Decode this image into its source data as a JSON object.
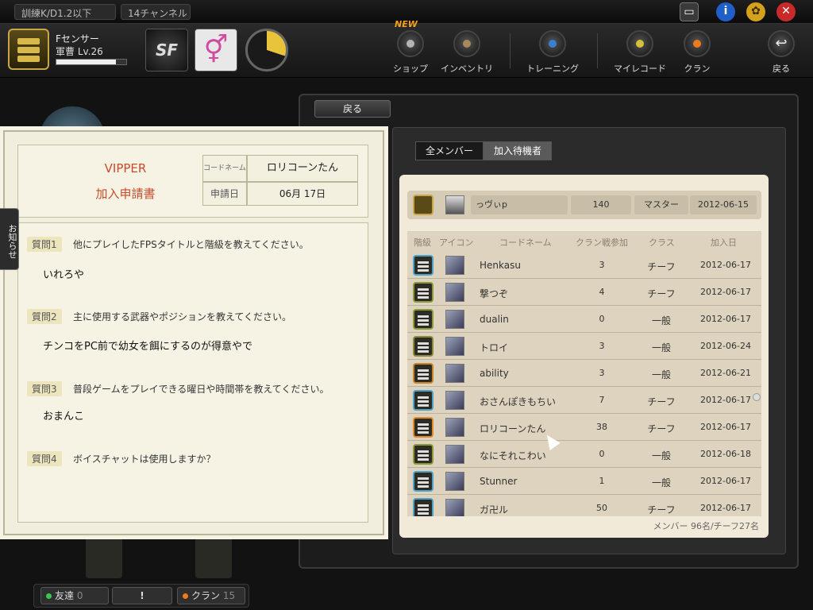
{
  "topbar": {
    "filter_label": "訓練K/D1.2以下",
    "channel_label": "14チャンネル"
  },
  "player": {
    "name": "Fセンサー",
    "rank": "軍曹 Lv.26",
    "xp_fraction": 0.85
  },
  "nav": {
    "new_badge": "NEW",
    "items": [
      {
        "label": "ショップ",
        "color": "#b5b5b5"
      },
      {
        "label": "インベントリ",
        "color": "#a88a5a"
      },
      {
        "label": "トレーニング",
        "color": "#3a7fd0"
      },
      {
        "label": "マイレコード",
        "color": "#d6c23a"
      },
      {
        "label": "クラン",
        "color": "#f07a1a"
      }
    ],
    "back_label": "戻る"
  },
  "panel": {
    "back_tab": "戻る",
    "tabs": [
      "全メンバー",
      "加入待機者"
    ]
  },
  "master": {
    "name": "っヴぃp",
    "count": "140",
    "class": "マスター",
    "date": "2012-06-15"
  },
  "columns": [
    "階級",
    "アイコン",
    "コードネーム",
    "クラン戦参加",
    "クラス",
    "加入日"
  ],
  "members": [
    {
      "name": "Henkasu",
      "count": "3",
      "class": "チーフ",
      "date": "2012-06-17",
      "rank_color": "#4ea2c8"
    },
    {
      "name": "撃つぞ",
      "count": "4",
      "class": "チーフ",
      "date": "2012-06-17",
      "rank_color": "#8a9a38"
    },
    {
      "name": "dualin",
      "count": "0",
      "class": "一般",
      "date": "2012-06-17",
      "rank_color": "#8a9a38"
    },
    {
      "name": "トロイ",
      "count": "3",
      "class": "一般",
      "date": "2012-06-24",
      "rank_color": "#8a8a38"
    },
    {
      "name": "ability",
      "count": "3",
      "class": "一般",
      "date": "2012-06-21",
      "rank_color": "#c8842a"
    },
    {
      "name": "おさんぽきもちい",
      "count": "7",
      "class": "チーフ",
      "date": "2012-06-17",
      "rank_color": "#4ea2c8"
    },
    {
      "name": "ロリコーンたん",
      "count": "38",
      "class": "チーフ",
      "date": "2012-06-17",
      "rank_color": "#e08a2a"
    },
    {
      "name": "なにそれこわい",
      "count": "0",
      "class": "一般",
      "date": "2012-06-18",
      "rank_color": "#8a9a38"
    },
    {
      "name": "Stunner",
      "count": "1",
      "class": "一般",
      "date": "2012-06-17",
      "rank_color": "#4ea2c8"
    },
    {
      "name": "ガ卍ル",
      "count": "50",
      "class": "チーフ",
      "date": "2012-06-17",
      "rank_color": "#4ea2c8"
    }
  ],
  "member_summary": "メンバー 96名/チーフ27名",
  "form": {
    "clan_name": "VIPPER",
    "form_title": "加入申請書",
    "codename_label": "コードネーム",
    "codename_value": "ロリコーンたん",
    "date_label": "申請日",
    "date_value": "06月 17日",
    "questions": [
      {
        "label": "質問1",
        "question": "他にプレイしたFPSタイトルと階級を教えてください。",
        "answer": "いれろや"
      },
      {
        "label": "質問2",
        "question": "主に使用する武器やポジションを教えてください。",
        "answer": "チンコをPC前で幼女を餌にするのが得意やで"
      },
      {
        "label": "質問3",
        "question": "普段ゲームをプレイできる曜日や時間帯を教えてください。",
        "answer": "おまんこ"
      },
      {
        "label": "質問4",
        "question": "ボイスチャットは使用しますか？",
        "answer": ""
      }
    ]
  },
  "side_tab": "お知らせ",
  "bottom": {
    "friends_label": "友達",
    "friends_count": "0",
    "alert_label": "!",
    "clan_label": "クラン",
    "clan_count": "15"
  }
}
